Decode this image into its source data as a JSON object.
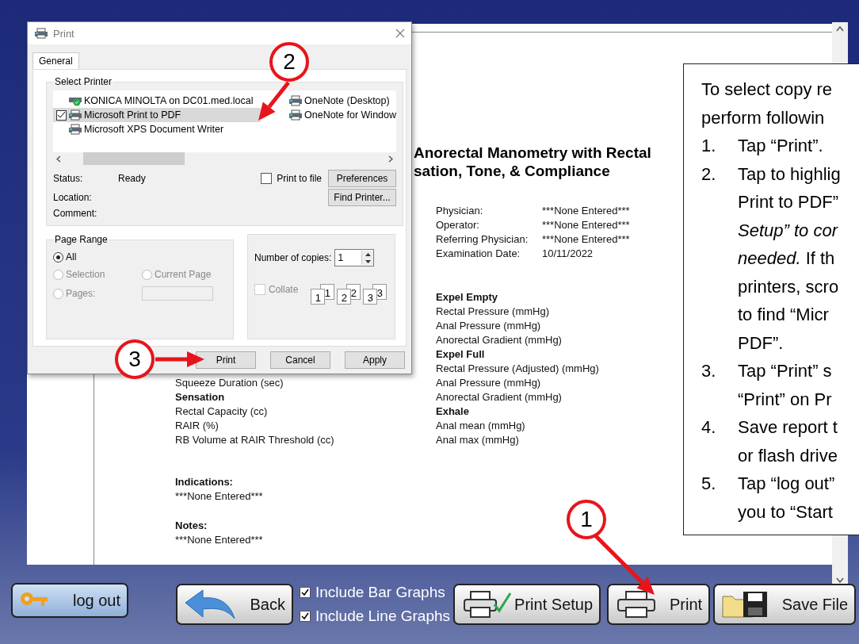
{
  "report": {
    "title_lines": [
      "Anorectal Manometry with Rectal",
      "sation, Tone, & Compliance"
    ],
    "info": [
      {
        "label": "Physician:",
        "value": "***None Entered***"
      },
      {
        "label": "Operator:",
        "value": "***None Entered***"
      },
      {
        "label": "Referring Physician:",
        "value": "***None Entered***"
      },
      {
        "label": "Examination Date:",
        "value": "10/11/2022"
      }
    ],
    "left_column": [
      {
        "kind": "item",
        "text": "Squeeze Duration (sec)"
      },
      {
        "kind": "heading",
        "text": "Sensation"
      },
      {
        "kind": "item",
        "text": "Rectal Capacity (cc)"
      },
      {
        "kind": "item",
        "text": "RAIR (%)"
      },
      {
        "kind": "item",
        "text": "RB Volume at RAIR Threshold (cc)"
      }
    ],
    "right_column": [
      {
        "kind": "heading",
        "text": "Expel Empty"
      },
      {
        "kind": "item",
        "text": "Rectal Pressure (mmHg)"
      },
      {
        "kind": "item",
        "text": "Anal Pressure (mmHg)"
      },
      {
        "kind": "item",
        "text": "Anorectal Gradient (mmHg)"
      },
      {
        "kind": "heading",
        "text": "Expel Full"
      },
      {
        "kind": "item",
        "text": "Rectal Pressure (Adjusted) (mmHg)"
      },
      {
        "kind": "item",
        "text": "Anal Pressure (mmHg)"
      },
      {
        "kind": "item",
        "text": "Anorectal Gradient (mmHg)"
      },
      {
        "kind": "heading",
        "text": "Exhale"
      },
      {
        "kind": "item",
        "text": "Anal mean (mmHg)"
      },
      {
        "kind": "item",
        "text": "Anal max (mmHg)"
      }
    ],
    "sections": [
      {
        "heading": "Indications:",
        "body": "***None Entered***"
      },
      {
        "heading": "Notes:",
        "body": "***None Entered***"
      }
    ]
  },
  "print_dialog": {
    "title": "Print",
    "tabs": [
      {
        "label": "General",
        "selected": true
      }
    ],
    "select_printer": {
      "legend": "Select Printer",
      "printers": [
        {
          "name": "KONICA MINOLTA on DC01.med.local",
          "selected": false,
          "default": true
        },
        {
          "name": "Microsoft Print to PDF",
          "selected": true,
          "default": false
        },
        {
          "name": "Microsoft XPS Document Writer",
          "selected": false,
          "default": false
        },
        {
          "name": "OneNote (Desktop)",
          "selected": false,
          "default": false
        },
        {
          "name": "OneNote for Window",
          "selected": false,
          "default": false
        }
      ],
      "fields": [
        {
          "label": "Status:",
          "value": "Ready"
        },
        {
          "label": "Location:"
        },
        {
          "label": "Comment:"
        }
      ],
      "print_to_file": {
        "label": "Print to file",
        "checked": false
      },
      "buttons": [
        "Preferences",
        "Find Printer..."
      ]
    },
    "page_range": {
      "legend": "Page Range",
      "options": [
        {
          "label": "All",
          "selected": true,
          "disabled": false
        },
        {
          "label": "Selection",
          "selected": false,
          "disabled": true
        },
        {
          "label": "Current Page",
          "selected": false,
          "disabled": true
        },
        {
          "label": "Pages:",
          "selected": false,
          "disabled": true
        }
      ],
      "pages_field": {
        "disabled": true
      }
    },
    "copies": {
      "label": "Number of copies:",
      "value": "1",
      "collate": {
        "label": "Collate",
        "checked": false,
        "disabled": true
      },
      "collate_pages": [
        "1",
        "1",
        "2",
        "2",
        "3",
        "3"
      ]
    },
    "buttons": [
      "Print",
      "Cancel",
      "Apply"
    ]
  },
  "instructions": {
    "intro": [
      "To select copy re",
      "perform followin"
    ],
    "steps": [
      {
        "number": "1.",
        "lines": [
          "Tap “Print”."
        ]
      },
      {
        "number": "2.",
        "lines": [
          "Tap to highlig",
          "Print to PDF”",
          "*Setup” to cor*",
          "*needed.* If th",
          "printers, scro",
          "to find “Micr",
          "PDF”."
        ]
      },
      {
        "number": "3.",
        "lines": [
          "Tap “Print” s",
          "“Print” on Pr"
        ]
      },
      {
        "number": "4.",
        "lines": [
          "Save report t",
          "or flash drive"
        ]
      },
      {
        "number": "5.",
        "lines": [
          "Tap “log out”",
          "you to “Start"
        ]
      }
    ]
  },
  "callouts": [
    "2",
    "3",
    "1"
  ],
  "toolbar": {
    "logout": "log out",
    "back": "Back",
    "options": [
      {
        "label": "Include Bar Graphs",
        "checked": true
      },
      {
        "label": "Include Line Graphs",
        "checked": true
      }
    ],
    "print_setup": "Print Setup",
    "print": "Print",
    "save_file": "Save File"
  }
}
